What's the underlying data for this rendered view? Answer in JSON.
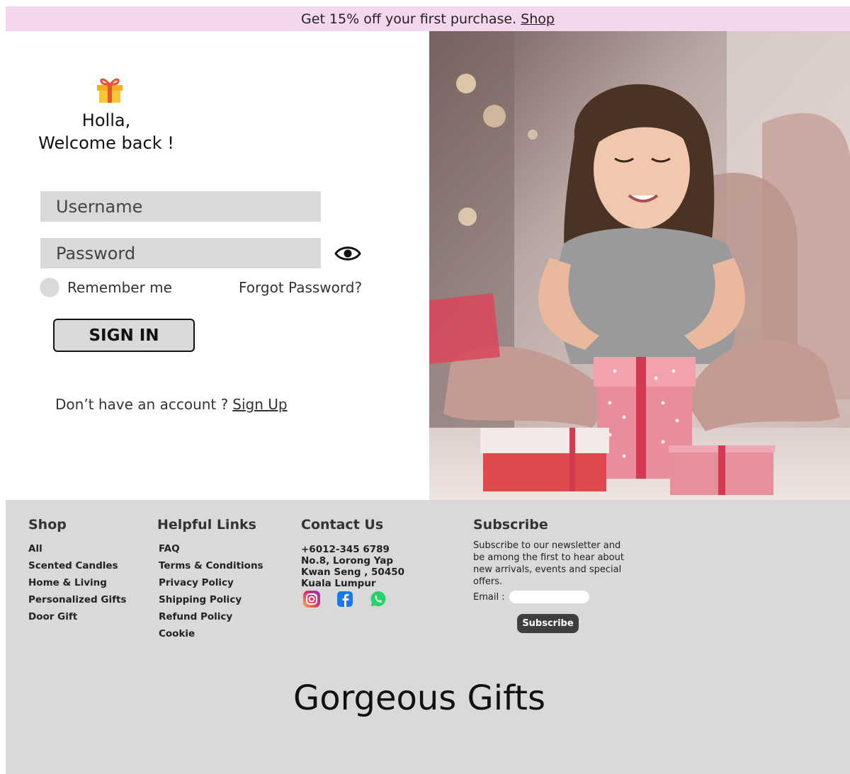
{
  "promo": {
    "text": "Get 15% off your first purchase.",
    "link": "Shop"
  },
  "login": {
    "greeting_line1": "Holla,",
    "greeting_line2": "Welcome back !",
    "username_placeholder": "Username",
    "password_placeholder": "Password",
    "remember_label": "Remember me",
    "forgot_label": "Forgot Password?",
    "signin_label": "SIGN IN",
    "no_account_text": "Don’t have an account ?",
    "signup_link": "Sign Up"
  },
  "footer": {
    "shop": {
      "title": "Shop",
      "items": [
        "All",
        "Scented Candles",
        "Home & Living",
        "Personalized Gifts",
        "Door Gift"
      ]
    },
    "helpful": {
      "title": "Helpful Links",
      "items": [
        "FAQ",
        "Terms & Conditions",
        "Privacy Policy",
        "Shipping Policy",
        "Refund Policy",
        "Cookie"
      ]
    },
    "contact": {
      "title": "Contact Us",
      "phone": "+6012-345 6789",
      "address": "No.8, Lorong Yap Kwan Seng , 50450 Kuala Lumpur",
      "socials": [
        "instagram-icon",
        "facebook-icon",
        "whatsapp-icon"
      ]
    },
    "subscribe": {
      "title": "Subscribe",
      "text": "Subscribe to our newsletter and be among the first to hear about new arrivals, events and special offers.",
      "email_label": "Email :",
      "button": "Subscribe"
    },
    "brand": "Gorgeous Gifts"
  },
  "colors": {
    "promo_bg": "#f4d6ef",
    "field_bg": "#d9d9d9",
    "footer_bg": "#d9d9d9",
    "subscribe_btn": "#3e3e3e",
    "instagram": "#d6249f",
    "facebook": "#1877f2",
    "whatsapp": "#25d366"
  }
}
